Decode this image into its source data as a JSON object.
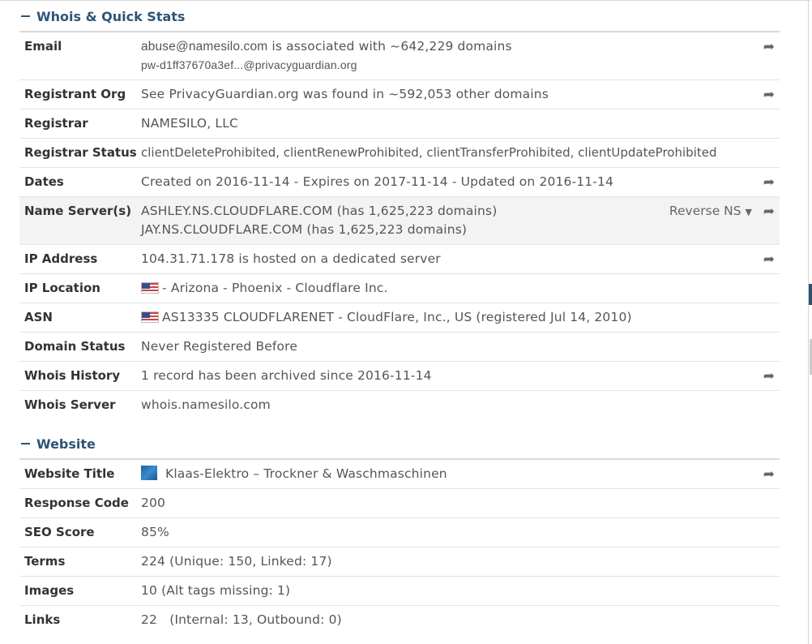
{
  "sections": {
    "whois_title": "Whois & Quick Stats",
    "website_title": "Website"
  },
  "whois": {
    "email": {
      "label": "Email",
      "line1_addr": "abuse@namesilo.com",
      "line1_rest": " is associated with ~642,229 domains",
      "line2": "pw-d1ff37670a3ef...@privacyguardian.org"
    },
    "registrant_org": {
      "label": "Registrant Org",
      "value": "See PrivacyGuardian.org was found in ~592,053 other domains"
    },
    "registrar": {
      "label": "Registrar",
      "value": "NAMESILO, LLC"
    },
    "registrar_status": {
      "label": "Registrar Status",
      "value": "clientDeleteProhibited, clientRenewProhibited, clientTransferProhibited, clientUpdateProhibited"
    },
    "dates": {
      "label": "Dates",
      "value": "Created on 2016-11-14 - Expires on 2017-11-14 - Updated on 2016-11-14"
    },
    "name_servers": {
      "label": "Name Server(s)",
      "line1": "ASHLEY.NS.CLOUDFLARE.COM (has 1,625,223 domains)",
      "line2": "JAY.NS.CLOUDFLARE.COM (has 1,625,223 domains)",
      "reverse_label": "Reverse NS"
    },
    "ip_address": {
      "label": "IP Address",
      "value": "104.31.71.178 is hosted on a dedicated server"
    },
    "ip_location": {
      "label": "IP Location",
      "value": "- Arizona - Phoenix - Cloudflare Inc."
    },
    "asn": {
      "label": "ASN",
      "value": "AS13335 CLOUDFLARENET - CloudFlare, Inc., US (registered Jul 14, 2010)"
    },
    "domain_status": {
      "label": "Domain Status",
      "value": "Never Registered Before"
    },
    "whois_history": {
      "label": "Whois History",
      "value": "1 record has been archived since 2016-11-14"
    },
    "whois_server": {
      "label": "Whois Server",
      "value": "whois.namesilo.com"
    }
  },
  "website": {
    "title": {
      "label": "Website Title",
      "value": "Klaas-Elektro – Trockner & Waschmaschinen"
    },
    "response_code": {
      "label": "Response Code",
      "value": "200"
    },
    "seo_score": {
      "label": "SEO Score",
      "value": "85%"
    },
    "terms": {
      "label": "Terms",
      "value": "224 (Unique: 150, Linked: 17)"
    },
    "images": {
      "label": "Images",
      "value": "10 (Alt tags missing: 1)"
    },
    "links": {
      "label": "Links",
      "value": "22   (Internal: 13, Outbound: 0)"
    }
  },
  "icons": {
    "share": "share-arrow-icon",
    "flag": "us-flag-icon",
    "caret": "caret-down-icon",
    "favicon": "site-favicon-icon"
  },
  "colors": {
    "section_title": "#2f5477",
    "row_shade": "#f3f3f3"
  }
}
